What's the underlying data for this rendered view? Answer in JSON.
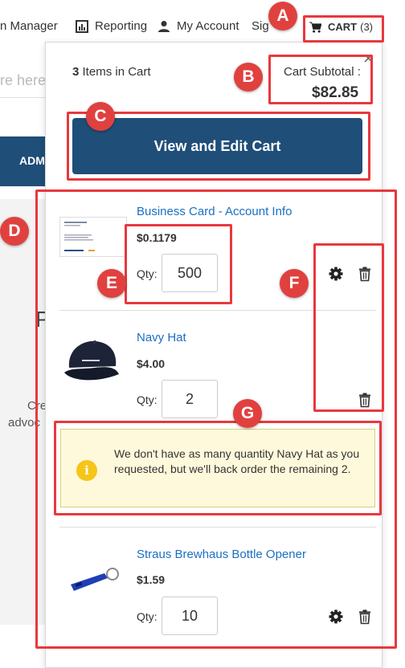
{
  "nav": {
    "manager": "n Manager",
    "reporting": "Reporting",
    "my_account": "My Account",
    "sign": "Sig",
    "cart_label": "CART",
    "cart_count": "(3)"
  },
  "background": {
    "search_fragment": "re here",
    "band_text": "ADM",
    "big_char": "P",
    "line1": "Cre",
    "line2": "advoc"
  },
  "cart": {
    "items_count": "3",
    "items_label": "Items in Cart",
    "close": "×",
    "subtotal_label": "Cart Subtotal :",
    "subtotal_value": "$82.85",
    "view_edit_label": "View and Edit Cart",
    "qty_label": "Qty:",
    "items": [
      {
        "name": "Business Card - Account Info",
        "price": "$0.1179",
        "qty": "500"
      },
      {
        "name": "Navy Hat",
        "price": "$4.00",
        "qty": "2"
      },
      {
        "name": "Straus Brewhaus Bottle Opener",
        "price": "$1.59",
        "qty": "10"
      }
    ],
    "warning": {
      "icon": "i",
      "text": "We don't have as many quantity Navy Hat as you requested, but we'll back order the remaining 2."
    }
  },
  "annotations": [
    "A",
    "B",
    "C",
    "D",
    "E",
    "F",
    "G"
  ],
  "colors": {
    "brand_blue": "#1f4e79",
    "link_blue": "#1a6fc4",
    "annotation_red": "#e0413f",
    "warning_bg": "#fff9dc",
    "warning_icon": "#f5c518"
  }
}
